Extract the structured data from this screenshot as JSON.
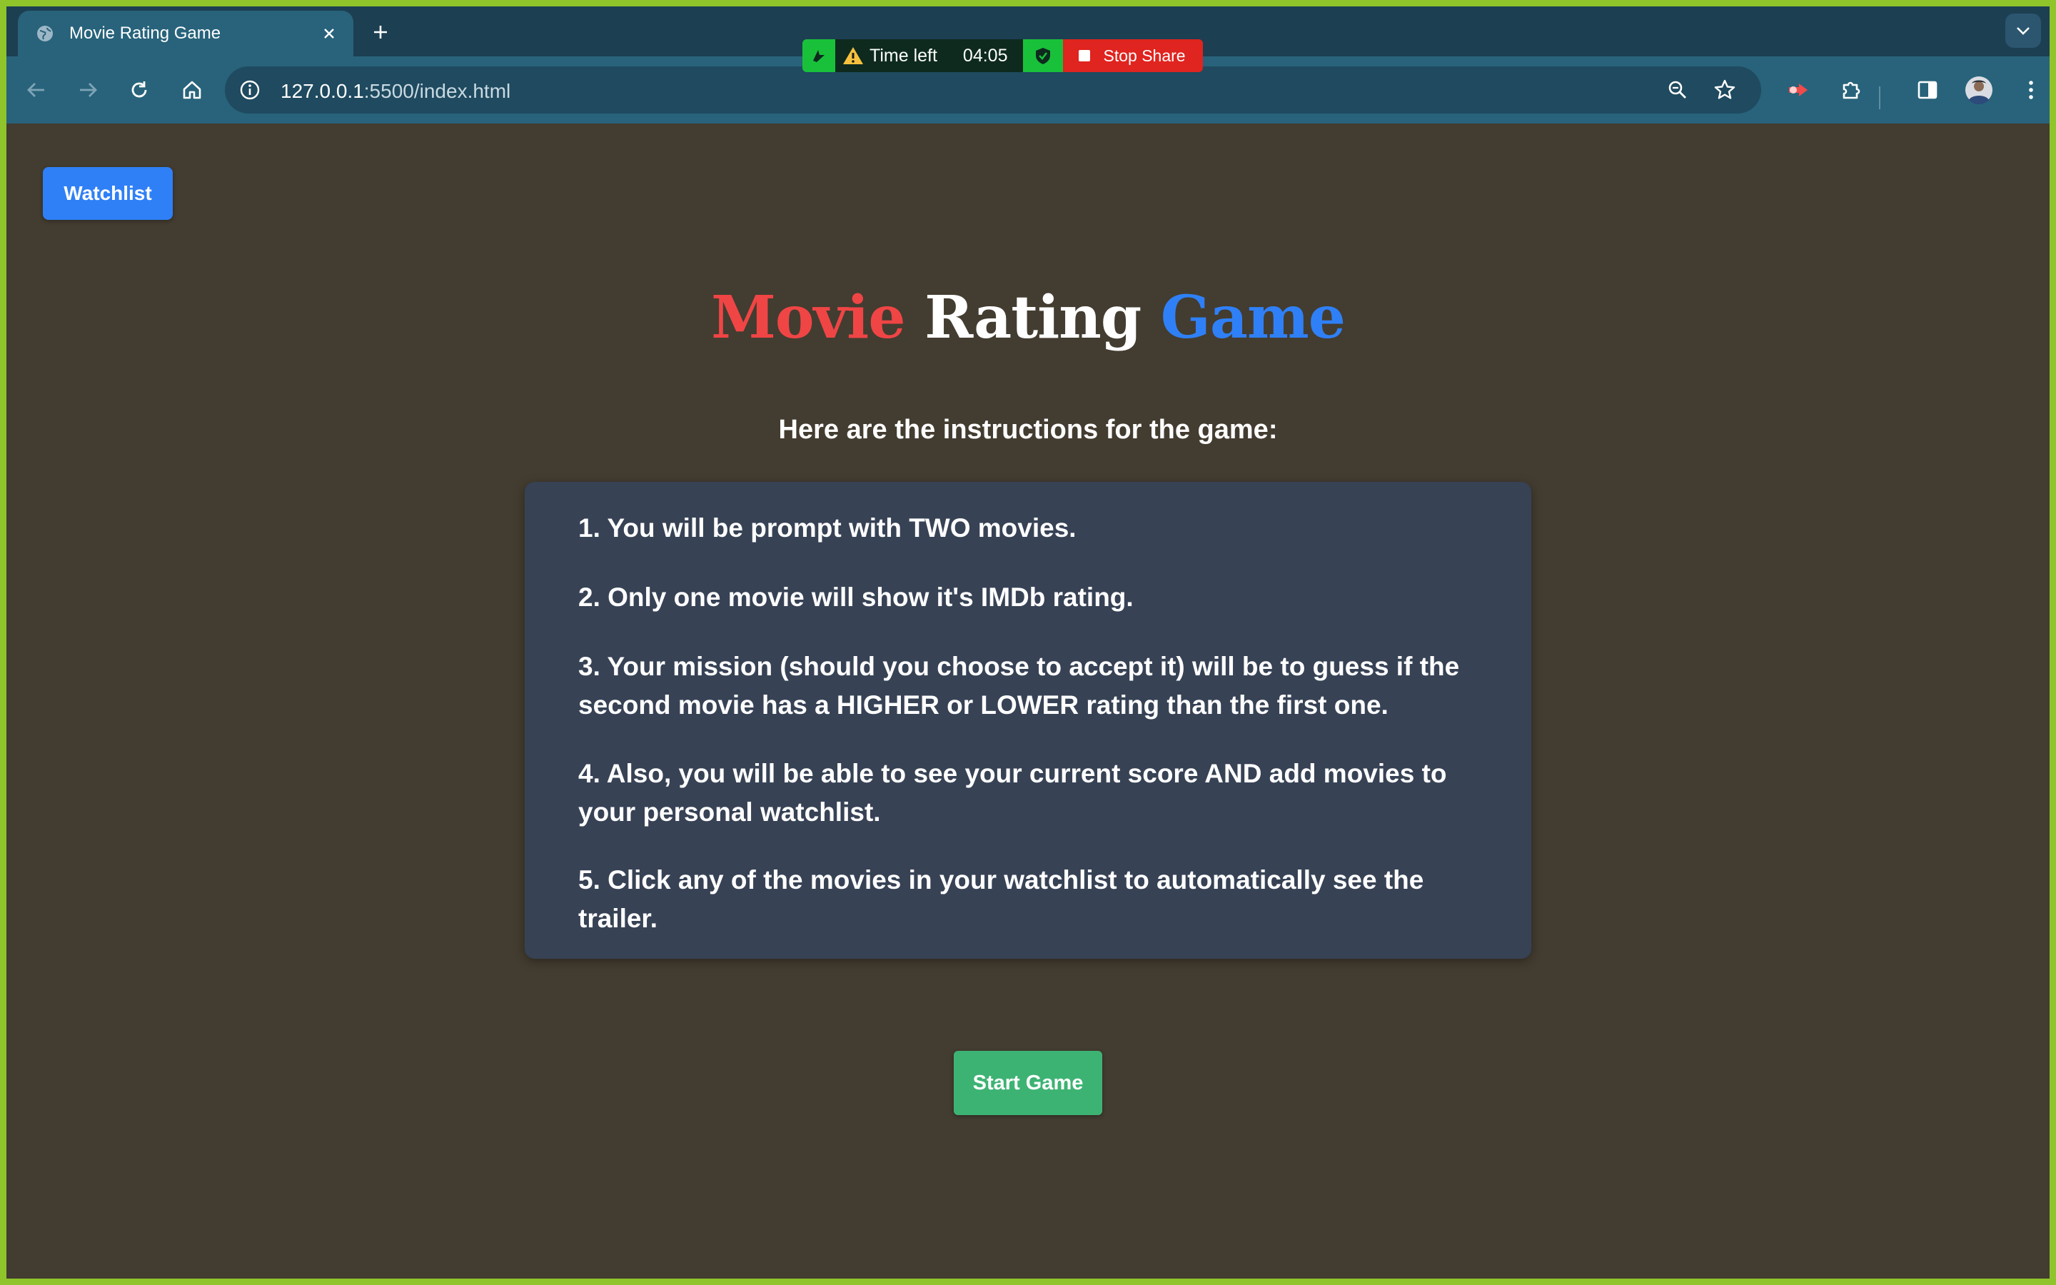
{
  "browser": {
    "tab": {
      "title": "Movie Rating Game",
      "favicon": "globe-icon",
      "close_icon": "close-icon"
    },
    "new_tab_icon": "plus-icon",
    "tab_search_icon": "chevron-down-icon",
    "toolbar": {
      "back_icon": "back-arrow-icon",
      "forward_icon": "forward-arrow-icon",
      "reload_icon": "reload-icon",
      "home_icon": "home-icon",
      "extensions": [
        "screen-share-extension-icon",
        "puzzle-icon",
        "side-panel-icon",
        "profile-avatar",
        "kebab-menu-icon"
      ]
    },
    "omnibox": {
      "url_host": "127.0.0.1",
      "url_rest": ":5500/index.html",
      "zoom_icon": "zoom-icon",
      "bookmark_icon": "star-icon"
    }
  },
  "share_banner": {
    "time_label": "Time left",
    "time_value": "04:05",
    "stop_label": "Stop Share",
    "colors": {
      "green": "#19c13b",
      "dark": "#0e2a1e",
      "stop": "#e0241f"
    }
  },
  "page": {
    "watchlist_button": "Watchlist",
    "title": {
      "word1": "Movie",
      "word2": "Rating",
      "word3": "Game"
    },
    "instructions_heading": "Here are the instructions for the game:",
    "steps": [
      "1. You will be prompt with TWO movies.",
      "2. Only one movie will show it's IMDb rating.",
      "3. Your mission (should you choose to accept it) will be to guess if the second movie has a HIGHER or LOWER rating than the first one.",
      "4. Also, you will be able to see your current score AND add movies to your personal watchlist.",
      "5. Click any of the movies in your watchlist to automatically see the trailer."
    ],
    "start_button": "Start Game",
    "colors": {
      "background": "#433c30",
      "card": "#374255",
      "watchlist_button": "#2f80f6",
      "start_button": "#3db373",
      "title_red": "#f04545",
      "title_blue": "#2f80f6"
    }
  }
}
